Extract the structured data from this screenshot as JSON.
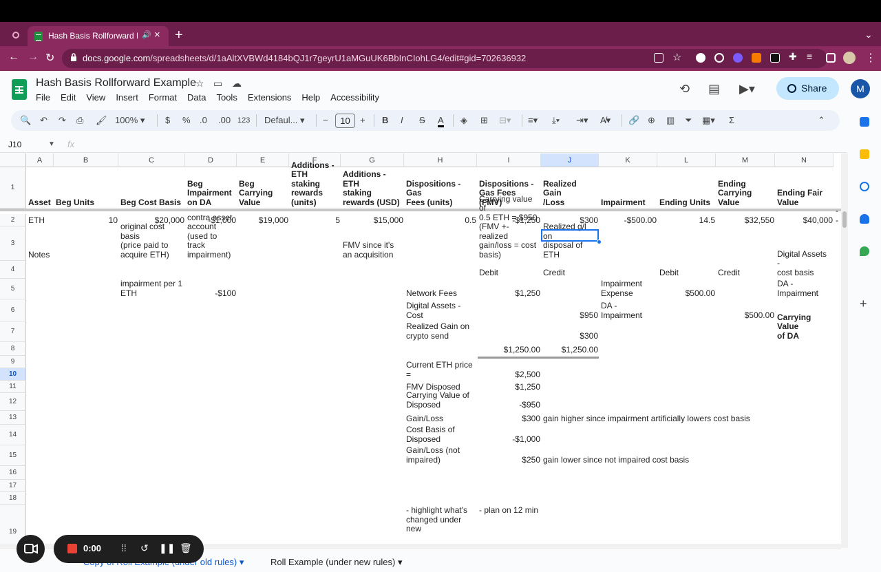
{
  "browser": {
    "tab_title": "Hash Basis Rollforward Ex",
    "new_tab": "+",
    "url_domain": "docs.google.com",
    "url_path": "/spreadsheets/d/1aAltXVBWd4184bQJ1r7geyrU1aMGuUK6BbInCIohLG4/edit#gid=702636932",
    "profile_initial": "M"
  },
  "sheets": {
    "doc_title": "Hash Basis Rollforward Example",
    "menus": [
      "File",
      "Edit",
      "View",
      "Insert",
      "Format",
      "Data",
      "Tools",
      "Extensions",
      "Help",
      "Accessibility"
    ],
    "share_label": "Share",
    "avatar_initial": "M",
    "toolbar": {
      "zoom": "100%",
      "currency": "$",
      "percent": "%",
      "dec_decrease": ".0",
      "dec_increase": ".00",
      "format_123": "123",
      "font": "Defaul...",
      "font_size": "10",
      "bold": "B",
      "italic": "I",
      "strike": "S",
      "text_color": "A",
      "sum": "Σ"
    },
    "name_box": "J10",
    "fx_label": "fx"
  },
  "grid": {
    "columns": [
      "A",
      "B",
      "C",
      "D",
      "E",
      "F",
      "G",
      "H",
      "I",
      "J",
      "K",
      "L",
      "M",
      "N"
    ],
    "rows": [
      "1",
      "2",
      "3",
      "4",
      "5",
      "6",
      "7",
      "8",
      "9",
      "10",
      "11",
      "12",
      "13",
      "14",
      "15",
      "16",
      "17",
      "18",
      "19"
    ],
    "header_row": {
      "A": "Asset",
      "B": "Beg Units",
      "C": "Beg Cost Basis",
      "D": "Beg\nImpairment\non DA",
      "E": "Beg\nCarrying\nValue",
      "F": "Additions -\nETH staking\nrewards\n(units)",
      "G": "Additions - ETH\nstaking\nrewards (USD)",
      "H": "Dispositions - Gas\nFees (units)",
      "I": "Dispositions -\nGas Fees (FMV)",
      "J": "Realized Gain\n/Loss",
      "K": "Impairment",
      "L": "Ending Units",
      "M": "Ending\nCarrying Value",
      "N": "Ending Fair\nValue"
    },
    "row2": {
      "A": "ETH",
      "B": "10",
      "C": "$20,000",
      "D": "-$1,000",
      "E": "$19,000",
      "F": "5",
      "G": "$15,000",
      "H": "0.5",
      "I": "-$1,250",
      "J": "$300",
      "K": "-$500.00",
      "L": "14.5",
      "M": "$32,550",
      "N": "$40,000",
      "O": "--"
    },
    "row3": {
      "A": "Notes",
      "C": "original cost basis\n(price paid to\nacquire ETH)",
      "D": "contra asset\naccount\n(used to track\nimpairment)",
      "G": "FMV since it's\nan acquisition",
      "I": "Carrying value of\n0.5 ETH = $950\n(FMV +- realized\ngain/loss = cost\nbasis)",
      "J": "Realized g/l on\ndisposal of\nETH"
    },
    "row4": {
      "I": "Debit",
      "J": "Credit",
      "L": "Debit",
      "M": "Credit",
      "N": "Digital Assets -\ncost basis"
    },
    "row5": {
      "C": "impairment per 1\nETH",
      "D": "-$100",
      "H": "Network Fees",
      "I": "$1,250",
      "K": "Impairment\nExpense",
      "L": "$500.00",
      "N": "DA -\nImpairment"
    },
    "row6": {
      "H": "Digital Assets -\nCost",
      "J": "$950",
      "K": "DA -\nImpairment",
      "M": "$500.00"
    },
    "row7": {
      "H": "Realized Gain on\ncrypto send",
      "J": "$300",
      "N": "Carrying Value\nof DA"
    },
    "row8": {
      "I": "$1,250.00",
      "J": "$1,250.00"
    },
    "row10": {
      "H": "Current ETH price =",
      "I": "$2,500"
    },
    "row11": {
      "H": "FMV Disposed",
      "I": "$1,250"
    },
    "row12": {
      "H": "Carrying Value of\nDisposed",
      "I": "-$950"
    },
    "row13": {
      "H": "Gain/Loss",
      "I": "$300",
      "J": "gain higher since impairment artificially lowers cost basis"
    },
    "row14": {
      "H": "Cost Basis of\nDisposed",
      "I": "-$1,000"
    },
    "row15": {
      "H": "Gain/Loss (not\nimpaired)",
      "I": "$250",
      "J": "gain lower since not impaired cost basis"
    },
    "row19": {
      "H": "- highlight what's\nchanged under new",
      "I": "- plan on 12 min"
    }
  },
  "sheet_tabs": {
    "active": "Copy of Roll Example (under old rules)",
    "other": "Roll Example (under new rules)"
  },
  "recorder": {
    "time": "0:00"
  },
  "colors": {
    "tabstrip": "#6b1e4a",
    "addressbar": "#8b2a5f",
    "share_bg": "#c2e7ff",
    "selection": "#1a73e8",
    "sheets_green": "#0f9d58"
  }
}
